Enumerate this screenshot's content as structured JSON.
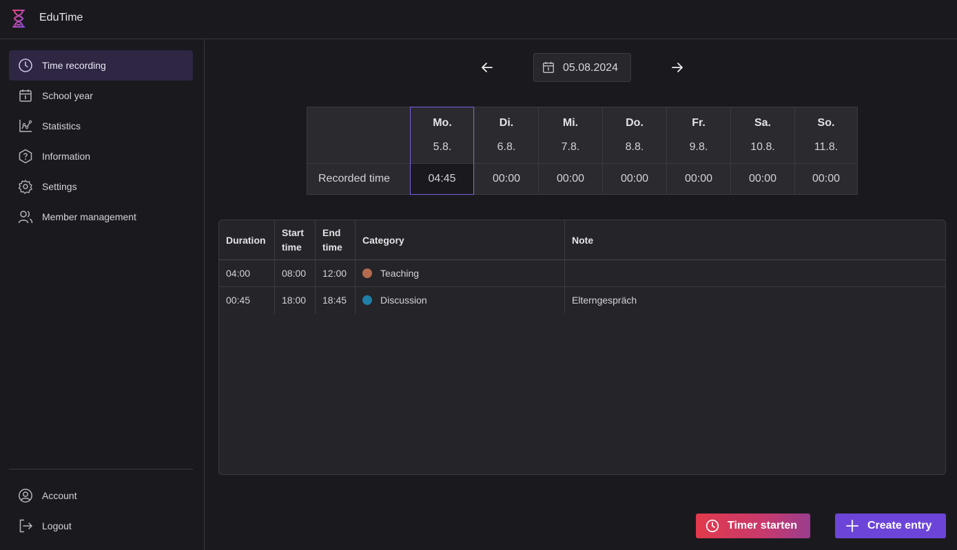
{
  "app": {
    "title": "EduTime"
  },
  "colors": {
    "accent": "#6c45d8",
    "teaching": "#b46a4e",
    "discussion": "#1f7fa6"
  },
  "sidebar": {
    "items": [
      {
        "label": "Time recording",
        "icon": "clock-icon",
        "active": true
      },
      {
        "label": "School year",
        "icon": "calendar-icon"
      },
      {
        "label": "Statistics",
        "icon": "chart-icon"
      },
      {
        "label": "Information",
        "icon": "info-hexagon-icon"
      },
      {
        "label": "Settings",
        "icon": "gear-icon"
      },
      {
        "label": "Member management",
        "icon": "users-icon"
      }
    ],
    "bottom": [
      {
        "label": "Account",
        "icon": "user-circle-icon"
      },
      {
        "label": "Logout",
        "icon": "logout-icon"
      }
    ]
  },
  "date_nav": {
    "date": "05.08.2024"
  },
  "week": {
    "row_label": "Recorded time",
    "days": [
      {
        "name": "Mo.",
        "date": "5.8.",
        "time": "04:45",
        "selected": true
      },
      {
        "name": "Di.",
        "date": "6.8.",
        "time": "00:00"
      },
      {
        "name": "Mi.",
        "date": "7.8.",
        "time": "00:00"
      },
      {
        "name": "Do.",
        "date": "8.8.",
        "time": "00:00"
      },
      {
        "name": "Fr.",
        "date": "9.8.",
        "time": "00:00"
      },
      {
        "name": "Sa.",
        "date": "10.8.",
        "time": "00:00"
      },
      {
        "name": "So.",
        "date": "11.8.",
        "time": "00:00"
      }
    ]
  },
  "entries": {
    "columns": [
      "Duration",
      "Start time",
      "End time",
      "Category",
      "Note"
    ],
    "rows": [
      {
        "duration": "04:00",
        "start": "08:00",
        "end": "12:00",
        "category": "Teaching",
        "note": ""
      },
      {
        "duration": "00:45",
        "start": "18:00",
        "end": "18:45",
        "category": "Discussion",
        "note": "Elterngespräch"
      }
    ]
  },
  "actions": {
    "timer_label": "Timer starten",
    "create_label": "Create entry"
  }
}
